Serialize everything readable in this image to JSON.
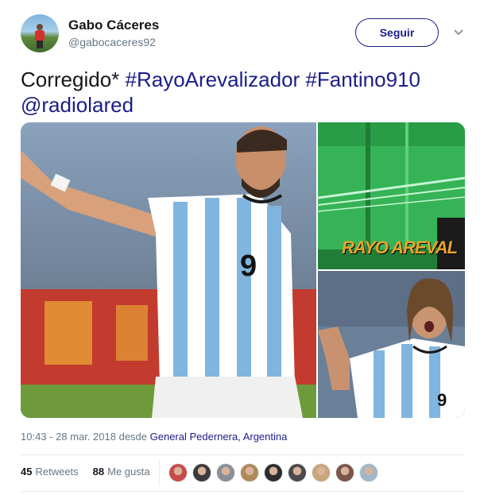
{
  "author": {
    "name": "Gabo Cáceres",
    "handle": "@gabocaceres92",
    "follow_label": "Seguir"
  },
  "tweet": {
    "text_plain": "Corregido* ",
    "hashtag1": "#RayoArevalizador",
    "hashtag2": "#Fantino910",
    "mention": "@radiolared"
  },
  "media": {
    "overlay_text": "RAYO AREVAL",
    "jersey_number_main": "9",
    "jersey_number_small": "9"
  },
  "meta": {
    "timestamp": "10:43 - 28 mar. 2018 desde ",
    "location": "General Pedernera, Argentina"
  },
  "stats": {
    "retweets_count": "45",
    "retweets_label": "Retweets",
    "likes_count": "88",
    "likes_label": "Me gusta"
  },
  "likers": [
    {
      "color": "#c94a4a"
    },
    {
      "color": "#3b3b3b"
    },
    {
      "color": "#8a8f95"
    },
    {
      "color": "#b08a5a"
    },
    {
      "color": "#2d2d2d"
    },
    {
      "color": "#4a4a4a"
    },
    {
      "color": "#c9a57a"
    },
    {
      "color": "#7a5548"
    },
    {
      "color": "#9fb7c9"
    }
  ],
  "colors": {
    "accent": "#1b1d8a",
    "muted": "#657786"
  }
}
